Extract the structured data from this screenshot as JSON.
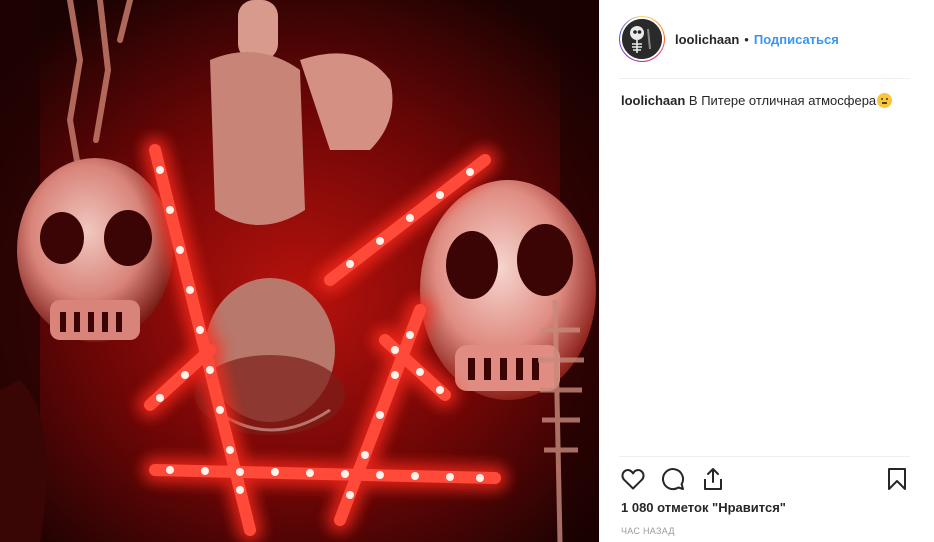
{
  "post": {
    "username": "loolichaan",
    "follow_label": "Подписаться",
    "separator": "•",
    "caption_user": "loolichaan",
    "caption_text": "В Питере отличная атмосфера",
    "likes_text": "1 080 отметок \"Нравится\"",
    "timestamp": "ЧАС НАЗАД"
  },
  "icons": {
    "like": "heart-outline-icon",
    "comment": "comment-bubble-icon",
    "share": "share-upload-icon",
    "save": "bookmark-icon",
    "caption_emoji": "smiling-face-emoji"
  },
  "colors": {
    "link_blue": "#3897f0",
    "text": "#262626",
    "muted": "#999999",
    "photo_red": "#e8241c"
  }
}
